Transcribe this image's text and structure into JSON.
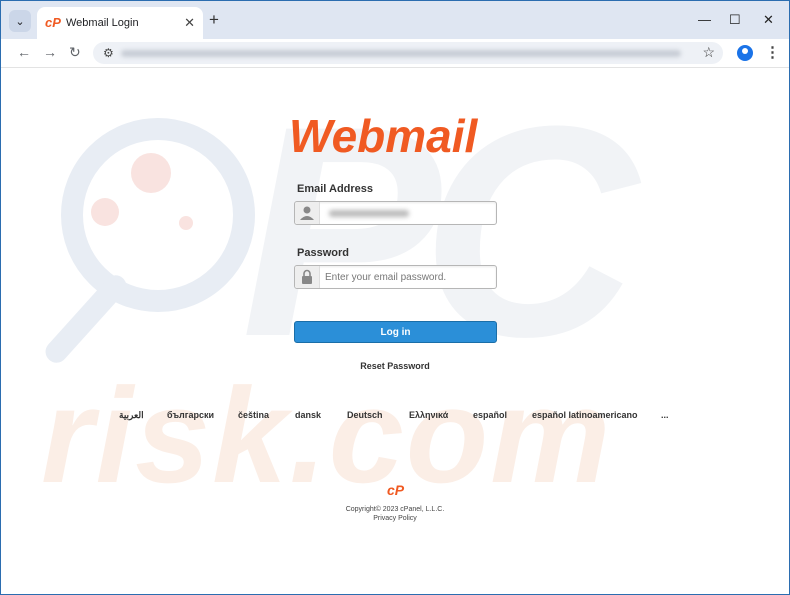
{
  "browser": {
    "tab_title": "Webmail Login",
    "tab_favicon": "cP",
    "new_tab_glyph": "+",
    "tab_close_glyph": "✕",
    "tab_menu_glyph": "⌄",
    "win_minimize": "—",
    "win_maximize": "☐",
    "win_close": "✕",
    "nav_back": "←",
    "nav_forward": "→",
    "nav_reload": "↻",
    "site_info_glyph": "⚙",
    "bookmark_glyph": "☆",
    "menu_glyph": "⋮"
  },
  "login": {
    "logo_text": "Webmail",
    "email_label": "Email Address",
    "password_label": "Password",
    "password_placeholder": "Enter your email password.",
    "login_button": "Log in",
    "reset_password": "Reset Password"
  },
  "languages": [
    "العربية",
    "български",
    "čeština",
    "dansk",
    "Deutsch",
    "Ελληνικά",
    "español",
    "español latinoamericano",
    "..."
  ],
  "footer": {
    "logo": "cP",
    "copyright": "Copyright© 2023 cPanel, L.L.C.",
    "privacy": "Privacy Policy"
  },
  "watermark": {
    "big": "PC",
    "small": "risk.com"
  },
  "colors": {
    "brand": "#f05a22",
    "button": "#2b8fd8",
    "chrome_tabbar": "#dfe6f2"
  }
}
